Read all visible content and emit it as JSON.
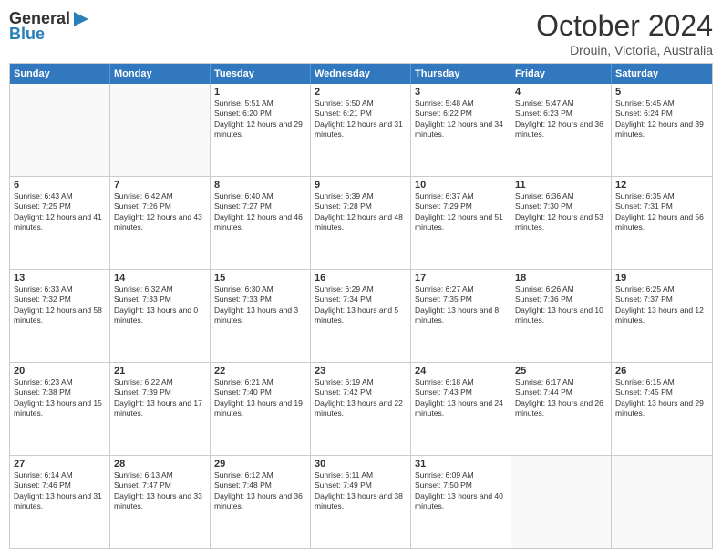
{
  "header": {
    "logo": {
      "general": "General",
      "blue": "Blue",
      "triangle_color": "#2980b9"
    },
    "title": "October 2024",
    "subtitle": "Drouin, Victoria, Australia"
  },
  "days_of_week": [
    "Sunday",
    "Monday",
    "Tuesday",
    "Wednesday",
    "Thursday",
    "Friday",
    "Saturday"
  ],
  "weeks": [
    [
      {
        "day": "",
        "empty": true
      },
      {
        "day": "",
        "empty": true
      },
      {
        "day": "1",
        "sunrise": "Sunrise: 5:51 AM",
        "sunset": "Sunset: 6:20 PM",
        "daylight": "Daylight: 12 hours and 29 minutes."
      },
      {
        "day": "2",
        "sunrise": "Sunrise: 5:50 AM",
        "sunset": "Sunset: 6:21 PM",
        "daylight": "Daylight: 12 hours and 31 minutes."
      },
      {
        "day": "3",
        "sunrise": "Sunrise: 5:48 AM",
        "sunset": "Sunset: 6:22 PM",
        "daylight": "Daylight: 12 hours and 34 minutes."
      },
      {
        "day": "4",
        "sunrise": "Sunrise: 5:47 AM",
        "sunset": "Sunset: 6:23 PM",
        "daylight": "Daylight: 12 hours and 36 minutes."
      },
      {
        "day": "5",
        "sunrise": "Sunrise: 5:45 AM",
        "sunset": "Sunset: 6:24 PM",
        "daylight": "Daylight: 12 hours and 39 minutes."
      }
    ],
    [
      {
        "day": "6",
        "sunrise": "Sunrise: 6:43 AM",
        "sunset": "Sunset: 7:25 PM",
        "daylight": "Daylight: 12 hours and 41 minutes."
      },
      {
        "day": "7",
        "sunrise": "Sunrise: 6:42 AM",
        "sunset": "Sunset: 7:26 PM",
        "daylight": "Daylight: 12 hours and 43 minutes."
      },
      {
        "day": "8",
        "sunrise": "Sunrise: 6:40 AM",
        "sunset": "Sunset: 7:27 PM",
        "daylight": "Daylight: 12 hours and 46 minutes."
      },
      {
        "day": "9",
        "sunrise": "Sunrise: 6:39 AM",
        "sunset": "Sunset: 7:28 PM",
        "daylight": "Daylight: 12 hours and 48 minutes."
      },
      {
        "day": "10",
        "sunrise": "Sunrise: 6:37 AM",
        "sunset": "Sunset: 7:29 PM",
        "daylight": "Daylight: 12 hours and 51 minutes."
      },
      {
        "day": "11",
        "sunrise": "Sunrise: 6:36 AM",
        "sunset": "Sunset: 7:30 PM",
        "daylight": "Daylight: 12 hours and 53 minutes."
      },
      {
        "day": "12",
        "sunrise": "Sunrise: 6:35 AM",
        "sunset": "Sunset: 7:31 PM",
        "daylight": "Daylight: 12 hours and 56 minutes."
      }
    ],
    [
      {
        "day": "13",
        "sunrise": "Sunrise: 6:33 AM",
        "sunset": "Sunset: 7:32 PM",
        "daylight": "Daylight: 12 hours and 58 minutes."
      },
      {
        "day": "14",
        "sunrise": "Sunrise: 6:32 AM",
        "sunset": "Sunset: 7:33 PM",
        "daylight": "Daylight: 13 hours and 0 minutes."
      },
      {
        "day": "15",
        "sunrise": "Sunrise: 6:30 AM",
        "sunset": "Sunset: 7:33 PM",
        "daylight": "Daylight: 13 hours and 3 minutes."
      },
      {
        "day": "16",
        "sunrise": "Sunrise: 6:29 AM",
        "sunset": "Sunset: 7:34 PM",
        "daylight": "Daylight: 13 hours and 5 minutes."
      },
      {
        "day": "17",
        "sunrise": "Sunrise: 6:27 AM",
        "sunset": "Sunset: 7:35 PM",
        "daylight": "Daylight: 13 hours and 8 minutes."
      },
      {
        "day": "18",
        "sunrise": "Sunrise: 6:26 AM",
        "sunset": "Sunset: 7:36 PM",
        "daylight": "Daylight: 13 hours and 10 minutes."
      },
      {
        "day": "19",
        "sunrise": "Sunrise: 6:25 AM",
        "sunset": "Sunset: 7:37 PM",
        "daylight": "Daylight: 13 hours and 12 minutes."
      }
    ],
    [
      {
        "day": "20",
        "sunrise": "Sunrise: 6:23 AM",
        "sunset": "Sunset: 7:38 PM",
        "daylight": "Daylight: 13 hours and 15 minutes."
      },
      {
        "day": "21",
        "sunrise": "Sunrise: 6:22 AM",
        "sunset": "Sunset: 7:39 PM",
        "daylight": "Daylight: 13 hours and 17 minutes."
      },
      {
        "day": "22",
        "sunrise": "Sunrise: 6:21 AM",
        "sunset": "Sunset: 7:40 PM",
        "daylight": "Daylight: 13 hours and 19 minutes."
      },
      {
        "day": "23",
        "sunrise": "Sunrise: 6:19 AM",
        "sunset": "Sunset: 7:42 PM",
        "daylight": "Daylight: 13 hours and 22 minutes."
      },
      {
        "day": "24",
        "sunrise": "Sunrise: 6:18 AM",
        "sunset": "Sunset: 7:43 PM",
        "daylight": "Daylight: 13 hours and 24 minutes."
      },
      {
        "day": "25",
        "sunrise": "Sunrise: 6:17 AM",
        "sunset": "Sunset: 7:44 PM",
        "daylight": "Daylight: 13 hours and 26 minutes."
      },
      {
        "day": "26",
        "sunrise": "Sunrise: 6:15 AM",
        "sunset": "Sunset: 7:45 PM",
        "daylight": "Daylight: 13 hours and 29 minutes."
      }
    ],
    [
      {
        "day": "27",
        "sunrise": "Sunrise: 6:14 AM",
        "sunset": "Sunset: 7:46 PM",
        "daylight": "Daylight: 13 hours and 31 minutes."
      },
      {
        "day": "28",
        "sunrise": "Sunrise: 6:13 AM",
        "sunset": "Sunset: 7:47 PM",
        "daylight": "Daylight: 13 hours and 33 minutes."
      },
      {
        "day": "29",
        "sunrise": "Sunrise: 6:12 AM",
        "sunset": "Sunset: 7:48 PM",
        "daylight": "Daylight: 13 hours and 36 minutes."
      },
      {
        "day": "30",
        "sunrise": "Sunrise: 6:11 AM",
        "sunset": "Sunset: 7:49 PM",
        "daylight": "Daylight: 13 hours and 38 minutes."
      },
      {
        "day": "31",
        "sunrise": "Sunrise: 6:09 AM",
        "sunset": "Sunset: 7:50 PM",
        "daylight": "Daylight: 13 hours and 40 minutes."
      },
      {
        "day": "",
        "empty": true
      },
      {
        "day": "",
        "empty": true
      }
    ]
  ]
}
